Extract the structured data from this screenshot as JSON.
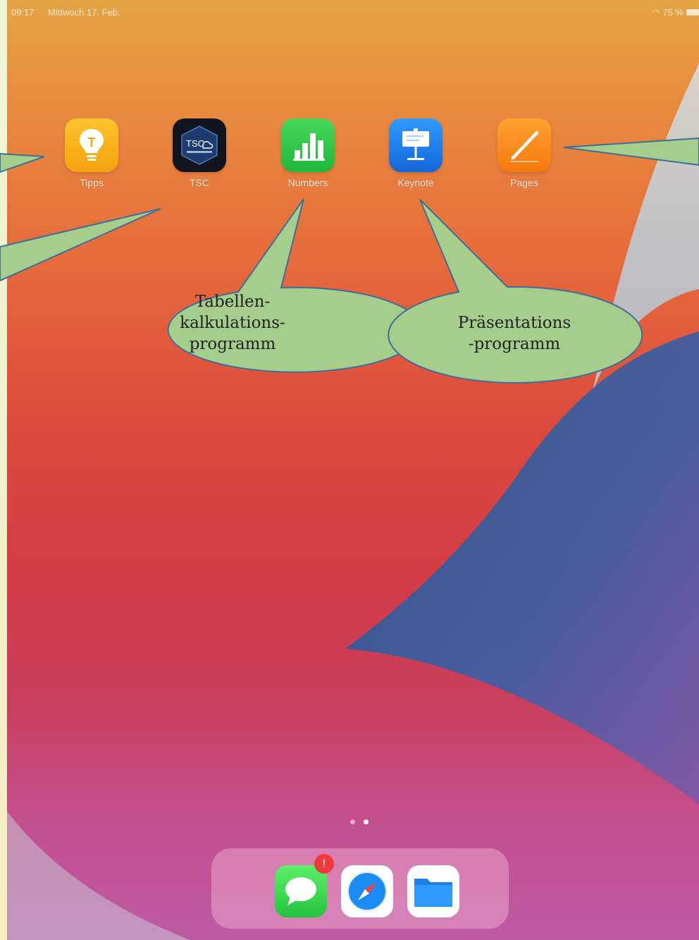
{
  "status_bar": {
    "time": "09:17",
    "date": "Mittwoch 17. Feb.",
    "battery": "75 %"
  },
  "apps": [
    {
      "name": "Tipps",
      "icon": "lightbulb-icon",
      "color": "#f7b217"
    },
    {
      "name": "TSC",
      "icon": "tsc-cloud-icon",
      "color": "#1c2a4a"
    },
    {
      "name": "Numbers",
      "icon": "bar-chart-icon",
      "color": "#2dc844"
    },
    {
      "name": "Keynote",
      "icon": "podium-icon",
      "color": "#1b82f0"
    },
    {
      "name": "Pages",
      "icon": "pencil-icon",
      "color": "#fb8c1a"
    }
  ],
  "annotations": [
    {
      "lines": [
        "Tabellen-",
        "kalkulations-",
        "programm"
      ]
    },
    {
      "lines": [
        "Präsentations",
        "-programm"
      ]
    }
  ],
  "page_indicator": {
    "pages": 2,
    "current": 2
  },
  "dock": {
    "apps": [
      {
        "icon": "messages-icon",
        "badge": "!"
      },
      {
        "icon": "safari-compass-icon"
      },
      {
        "icon": "files-folder-icon"
      }
    ]
  },
  "colors": {
    "callout_fill": "#a5cd8b",
    "callout_stroke": "#3f6f98",
    "frame": "#eef5d6"
  }
}
